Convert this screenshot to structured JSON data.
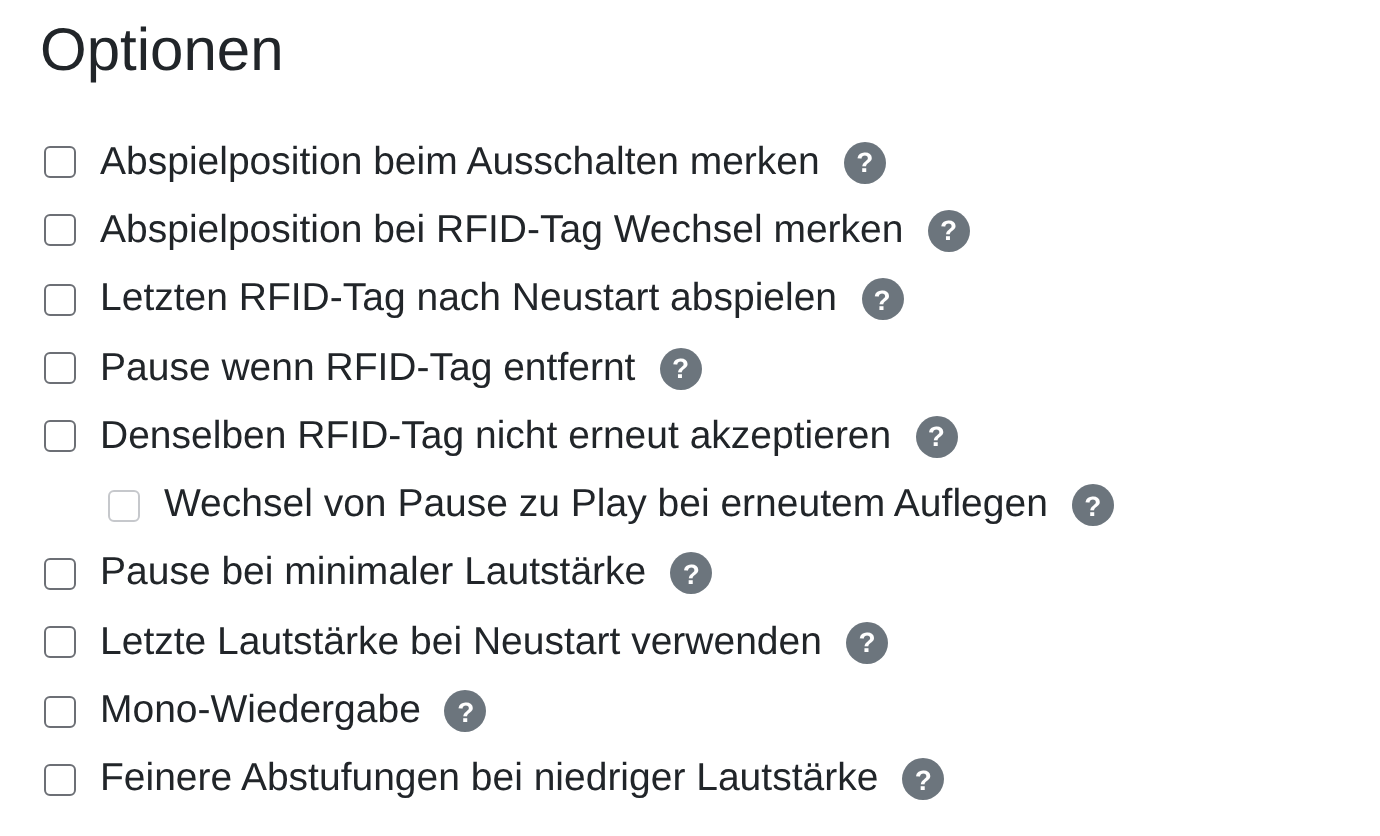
{
  "title": "Optionen",
  "options": [
    {
      "label": "Abspielposition beim Ausschalten merken",
      "checked": false,
      "disabled": false,
      "help": "?"
    },
    {
      "label": "Abspielposition bei RFID-Tag Wechsel merken",
      "checked": false,
      "disabled": false,
      "help": "?"
    },
    {
      "label": "Letzten RFID-Tag nach Neustart abspielen",
      "checked": false,
      "disabled": false,
      "help": "?"
    },
    {
      "label": "Pause wenn RFID-Tag entfernt",
      "checked": false,
      "disabled": false,
      "help": "?"
    },
    {
      "label": "Denselben RFID-Tag nicht erneut akzeptieren",
      "checked": false,
      "disabled": false,
      "help": "?",
      "children": [
        {
          "label": "Wechsel von Pause zu Play bei erneutem Auflegen",
          "checked": false,
          "disabled": true,
          "help": "?"
        }
      ]
    },
    {
      "label": "Pause bei minimaler Lautstärke",
      "checked": false,
      "disabled": false,
      "help": "?"
    },
    {
      "label": "Letzte Lautstärke bei Neustart verwenden",
      "checked": false,
      "disabled": false,
      "help": "?"
    },
    {
      "label": "Mono-Wiedergabe",
      "checked": false,
      "disabled": false,
      "help": "?"
    },
    {
      "label": "Feinere Abstufungen bei niedriger Lautstärke",
      "checked": false,
      "disabled": false,
      "help": "?"
    }
  ]
}
